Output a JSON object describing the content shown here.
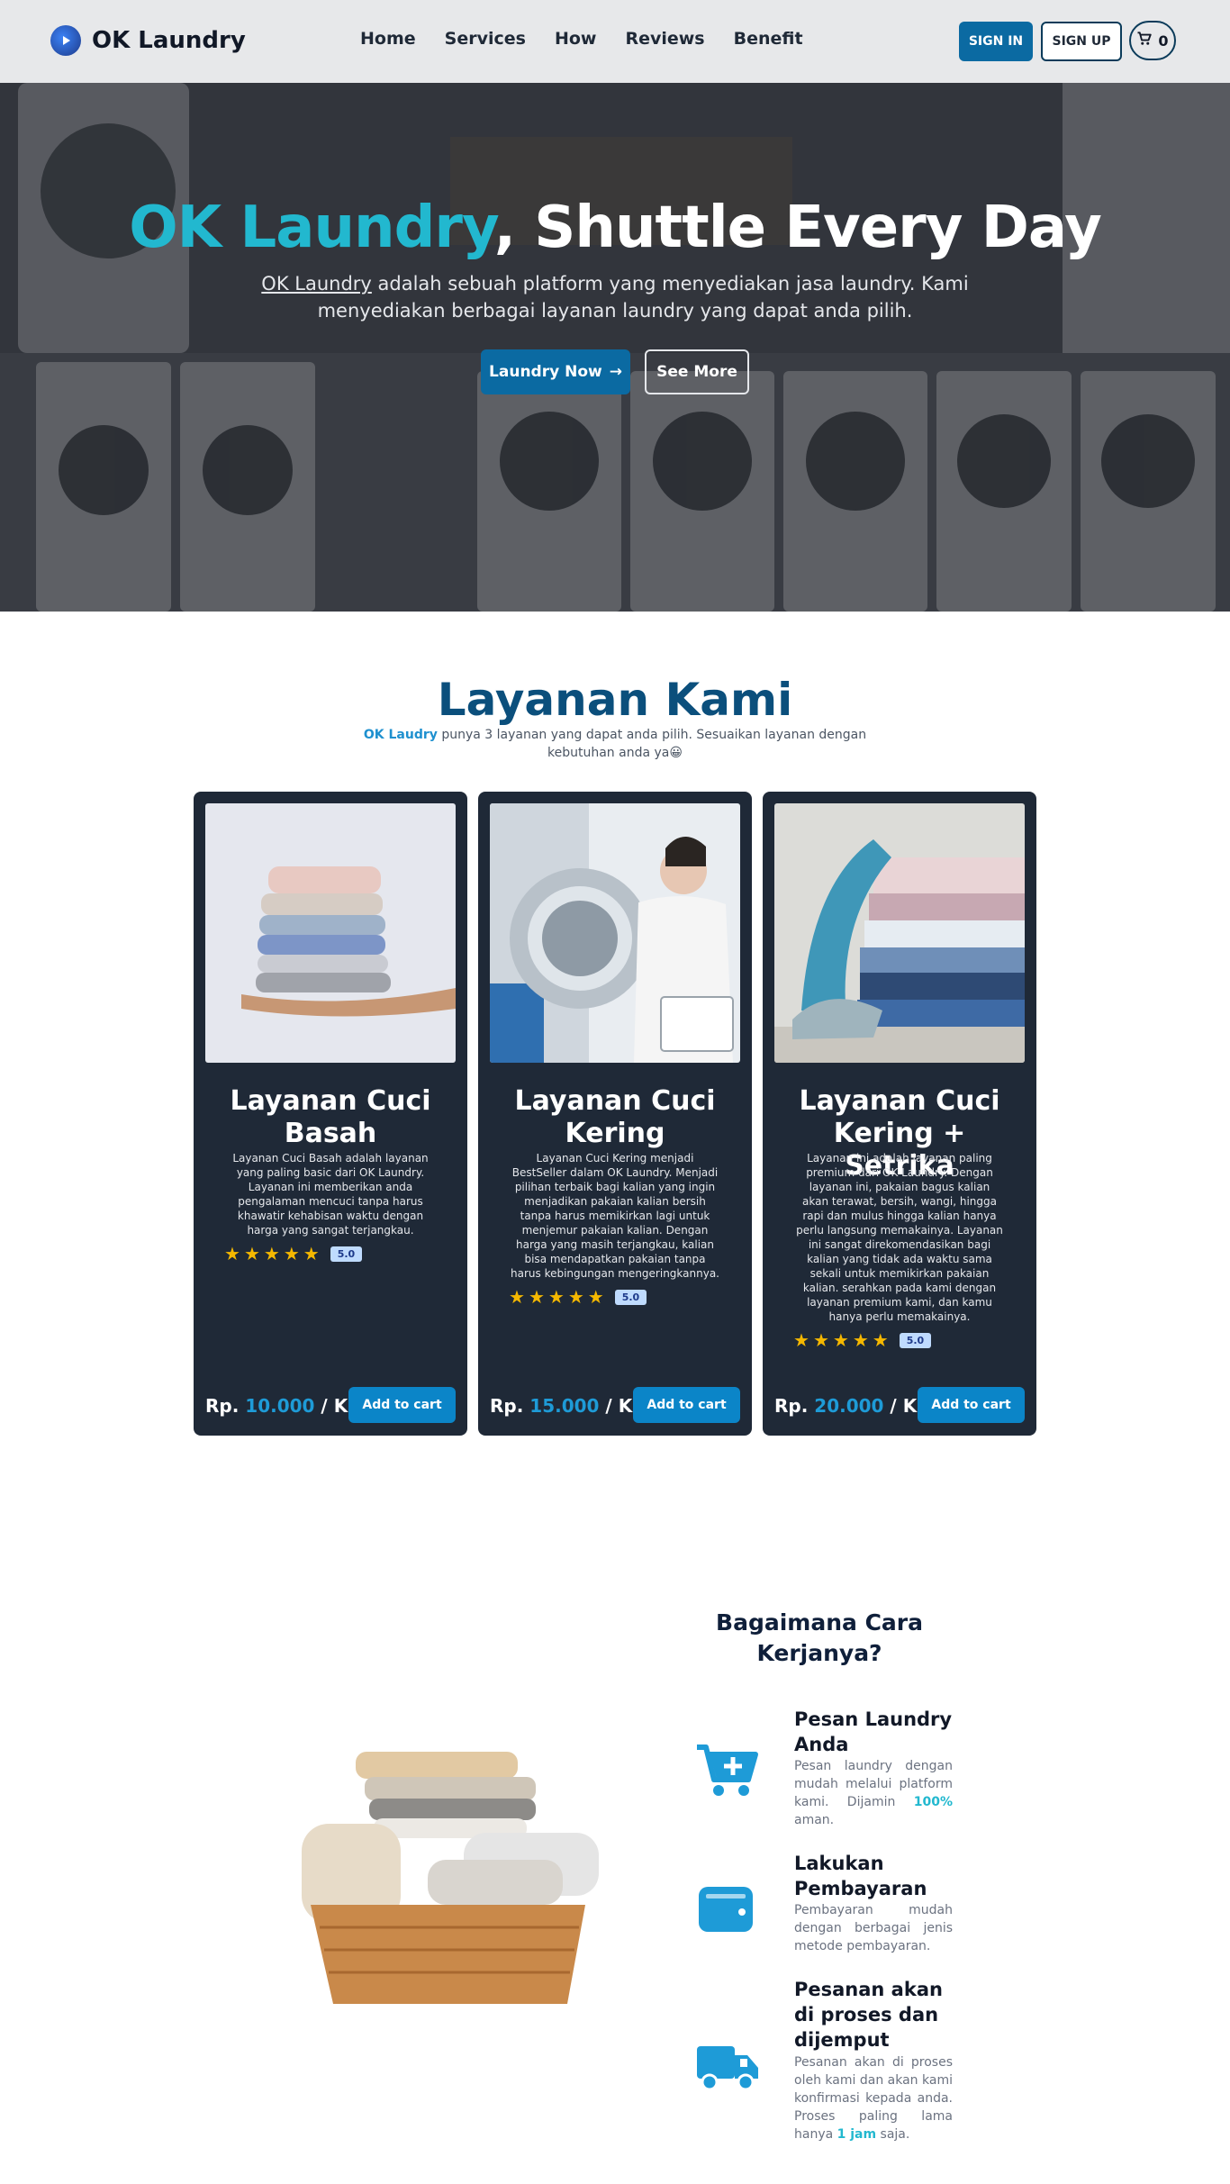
{
  "navbar": {
    "brand": "OK Laundry",
    "links": [
      "Home",
      "Services",
      "How",
      "Reviews",
      "Benefit"
    ],
    "signin": "SIGN IN",
    "signup": "SIGN UP",
    "cart_count": "0"
  },
  "hero": {
    "title_accent": "OK Laundry",
    "title_rest": ", Shuttle Every Day",
    "sub_link": "OK Laundry",
    "sub_rest": " adalah sebuah platform yang menyediakan jasa laundry. Kami menyediakan berbagai layanan laundry yang dapat anda pilih.",
    "btn_primary": "Laundry Now",
    "btn_secondary": "See More"
  },
  "services": {
    "title": "Layanan Kami",
    "sub_brand": "OK Laudry",
    "sub_rest": " punya 3 layanan yang dapat anda pilih. Sesuaikan layanan dengan kebutuhan anda ya😀",
    "cards": [
      {
        "title": "Layanan Cuci Basah",
        "desc": "Layanan Cuci Basah adalah layanan yang paling basic dari OK Laundry. Layanan ini memberikan anda pengalaman mencuci tanpa harus khawatir kehabisan waktu dengan harga yang sangat terjangkau.",
        "rating": "5.0",
        "price_prefix": "Rp. ",
        "price_amount": "10.000",
        "price_unit": " / Kg",
        "button": "Add to cart"
      },
      {
        "title": "Layanan Cuci Kering",
        "desc": "Layanan Cuci Kering menjadi BestSeller dalam OK Laundry. Menjadi pilihan terbaik bagi kalian yang ingin menjadikan pakaian kalian bersih tanpa harus memikirkan lagi untuk menjemur pakaian kalian. Dengan harga yang masih terjangkau, kalian bisa mendapatkan pakaian tanpa harus kebingungan mengeringkannya.",
        "rating": "5.0",
        "price_prefix": "Rp. ",
        "price_amount": "15.000",
        "price_unit": " / Kg",
        "button": "Add to cart"
      },
      {
        "title": "Layanan Cuci Kering + Setrika",
        "desc": "Layanan ini adalah layanan paling premium dari OK Laundry. Dengan layanan ini, pakaian bagus kalian akan terawat, bersih, wangi, hingga rapi dan mulus hingga kalian hanya perlu langsung memakainya. Layanan ini sangat direkomendasikan bagi kalian yang tidak ada waktu sama sekali untuk memikirkan pakaian kalian. serahkan pada kami dengan layanan premium kami, dan kamu hanya perlu memakainya.",
        "rating": "5.0",
        "price_prefix": "Rp. ",
        "price_amount": "20.000",
        "price_unit": " / Kg",
        "button": "Add to cart"
      }
    ]
  },
  "how": {
    "title": "Bagaimana Cara Kerjanya?",
    "steps": [
      {
        "icon": "cart-plus-icon",
        "title": "Pesan Laundry Anda",
        "desc_a": "Pesan laundry dengan mudah melalui platform kami. Dijamin ",
        "desc_hl": "100%",
        "desc_b": " aman."
      },
      {
        "icon": "wallet-icon",
        "title": "Lakukan Pembayaran",
        "desc_a": "Pembayaran mudah dengan berbagai jenis metode pembayaran.",
        "desc_hl": "",
        "desc_b": ""
      },
      {
        "icon": "truck-icon",
        "title": "Pesanan akan di proses dan dijemput",
        "desc_a": "Pesanan akan di proses oleh kami dan akan kami konfirmasi kepada anda. Proses paling lama hanya ",
        "desc_hl": "1 jam",
        "desc_b": " saja."
      }
    ]
  },
  "colors": {
    "accent": "#22b8cf",
    "primary": "#0b6aa2",
    "card_bg": "#1f2937",
    "icon_blue": "#1e9bd7"
  }
}
